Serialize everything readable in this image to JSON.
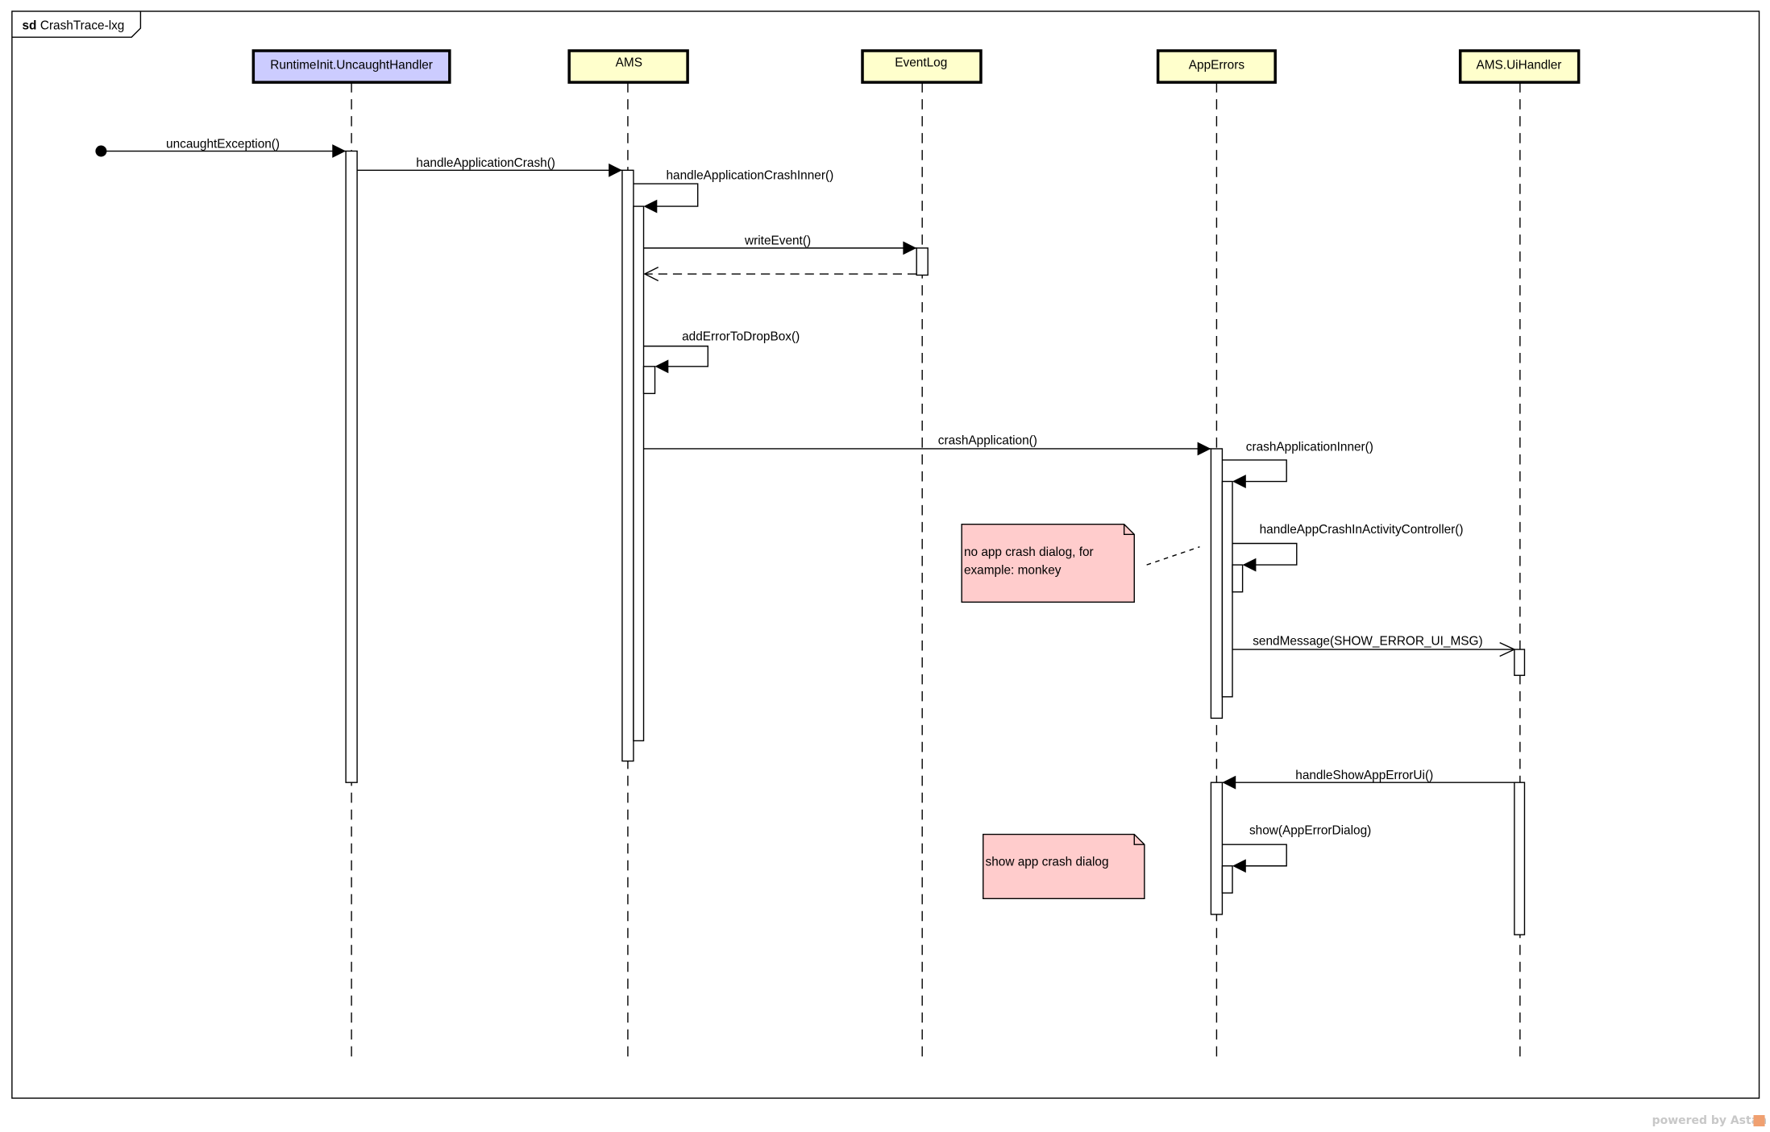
{
  "diagram": {
    "frame_keyword": "sd",
    "frame_name": "CrashTrace-lxg",
    "lifelines": [
      {
        "id": "runtime",
        "label": "RuntimeInit.UncaughtHandler",
        "fill": "#ccccff"
      },
      {
        "id": "ams",
        "label": "AMS",
        "fill": "#ffffcc"
      },
      {
        "id": "eventlog",
        "label": "EventLog",
        "fill": "#ffffcc"
      },
      {
        "id": "apperrors",
        "label": "AppErrors",
        "fill": "#ffffcc"
      },
      {
        "id": "uihandler",
        "label": "AMS.UiHandler",
        "fill": "#ffffcc"
      }
    ],
    "messages": [
      {
        "label": "uncaughtException()",
        "from": "found",
        "to": "runtime",
        "kind": "sync"
      },
      {
        "label": "handleApplicationCrash()",
        "from": "runtime",
        "to": "ams",
        "kind": "sync"
      },
      {
        "label": "handleApplicationCrashInner()",
        "from": "ams",
        "to": "ams",
        "kind": "self"
      },
      {
        "label": "writeEvent()",
        "from": "ams",
        "to": "eventlog",
        "kind": "sync"
      },
      {
        "label": "",
        "from": "eventlog",
        "to": "ams",
        "kind": "return"
      },
      {
        "label": "addErrorToDropBox()",
        "from": "ams",
        "to": "ams",
        "kind": "self"
      },
      {
        "label": "crashApplication()",
        "from": "ams",
        "to": "apperrors",
        "kind": "sync"
      },
      {
        "label": "crashApplicationInner()",
        "from": "apperrors",
        "to": "apperrors",
        "kind": "self"
      },
      {
        "label": "handleAppCrashInActivityController()",
        "from": "apperrors",
        "to": "apperrors",
        "kind": "self"
      },
      {
        "label": "sendMessage(SHOW_ERROR_UI_MSG)",
        "from": "apperrors",
        "to": "uihandler",
        "kind": "async"
      },
      {
        "label": "handleShowAppErrorUi()",
        "from": "uihandler",
        "to": "apperrors",
        "kind": "sync"
      },
      {
        "label": "show(AppErrorDialog)",
        "from": "apperrors",
        "to": "apperrors",
        "kind": "self"
      }
    ],
    "notes": [
      {
        "lines": [
          "no app crash dialog, for",
          "example: monkey"
        ],
        "fill": "#ffcccc"
      },
      {
        "lines": [
          "show app crash dialog"
        ],
        "fill": "#ffcccc"
      }
    ],
    "watermark": "powered by Astah"
  }
}
